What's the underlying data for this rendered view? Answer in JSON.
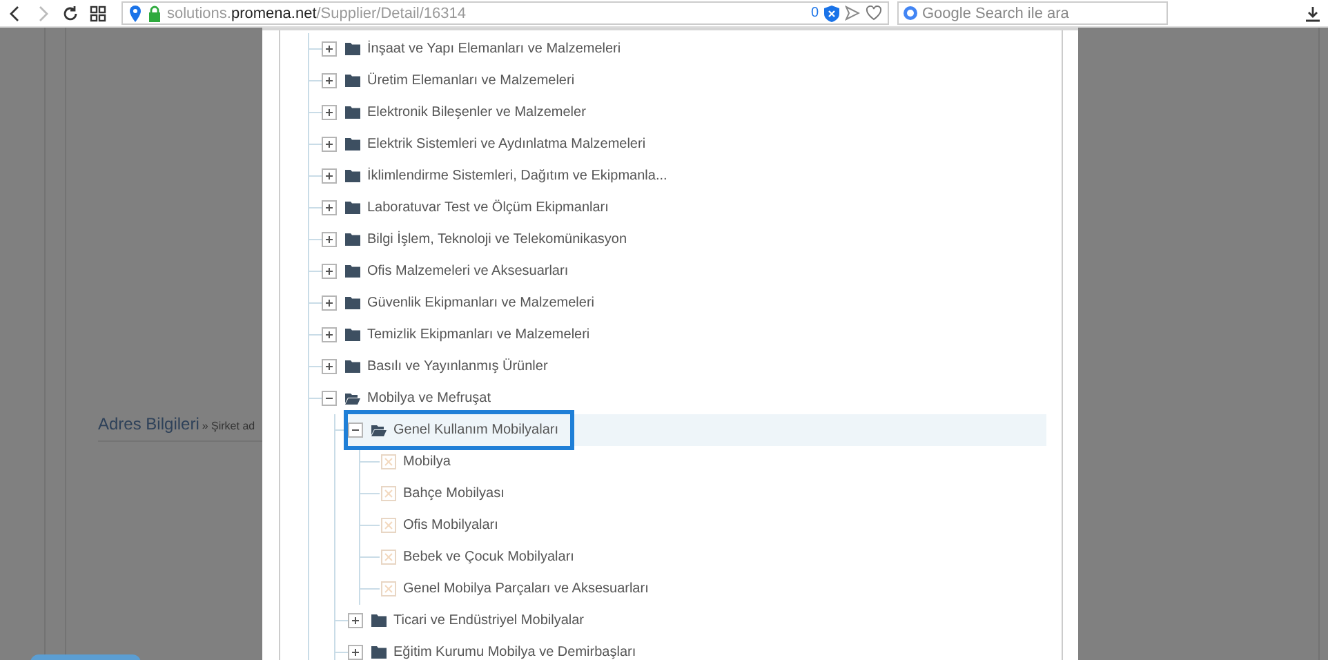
{
  "browser": {
    "url": "solutions.**promena.net**/Supplier/Detail/16314",
    "badge_count": "0",
    "search": {
      "placeholder": "Google Search ile ara"
    }
  },
  "background_page": {
    "section_title": "Adres Bilgileri",
    "breadcrumb": "» Şirket ad"
  },
  "category_tree": [
    {
      "label": "İnşaat ve Yapı Elemanları ve Malzemeleri",
      "kind": "folder",
      "expanded": false,
      "selected": false
    },
    {
      "label": "Üretim Elemanları ve Malzemeleri",
      "kind": "folder",
      "expanded": false,
      "selected": false
    },
    {
      "label": "Elektronik Bileşenler ve Malzemeler",
      "kind": "folder",
      "expanded": false,
      "selected": false
    },
    {
      "label": "Elektrik Sistemleri ve Aydınlatma Malzemeleri",
      "kind": "folder",
      "expanded": false,
      "selected": false
    },
    {
      "label": "İklimlendirme Sistemleri, Dağıtım ve Ekipmanla...",
      "kind": "folder",
      "expanded": false,
      "selected": false
    },
    {
      "label": "Laboratuvar Test ve Ölçüm Ekipmanları",
      "kind": "folder",
      "expanded": false,
      "selected": false
    },
    {
      "label": "Bilgi İşlem, Teknoloji ve Telekomünikasyon",
      "kind": "folder",
      "expanded": false,
      "selected": false
    },
    {
      "label": "Ofis Malzemeleri ve Aksesuarları",
      "kind": "folder",
      "expanded": false,
      "selected": false
    },
    {
      "label": "Güvenlik Ekipmanları ve Malzemeleri",
      "kind": "folder",
      "expanded": false,
      "selected": false
    },
    {
      "label": "Temizlik Ekipmanları ve Malzemeleri",
      "kind": "folder",
      "expanded": false,
      "selected": false
    },
    {
      "label": "Basılı ve Yayınlanmış Ürünler",
      "kind": "folder",
      "expanded": false,
      "selected": false
    },
    {
      "label": "Mobilya ve Mefruşat",
      "kind": "folder",
      "expanded": true,
      "selected": false,
      "children": [
        {
          "label": "Genel Kullanım Mobilyaları",
          "kind": "folder",
          "expanded": true,
          "selected": true,
          "children": [
            {
              "label": "Mobilya",
              "kind": "leaf",
              "checked": false,
              "selected": false
            },
            {
              "label": "Bahçe Mobilyası",
              "kind": "leaf",
              "checked": false,
              "selected": false
            },
            {
              "label": "Ofis Mobilyaları",
              "kind": "leaf",
              "checked": false,
              "selected": false
            },
            {
              "label": "Bebek ve Çocuk Mobilyaları",
              "kind": "leaf",
              "checked": false,
              "selected": false
            },
            {
              "label": "Genel Mobilya Parçaları ve Aksesuarları",
              "kind": "leaf",
              "checked": false,
              "selected": false
            }
          ]
        },
        {
          "label": "Ticari ve Endüstriyel Mobilyalar",
          "kind": "folder",
          "expanded": false,
          "selected": false
        },
        {
          "label": "Eğitim Kurumu Mobilya ve Demirbaşları",
          "kind": "folder",
          "expanded": false,
          "selected": false
        }
      ]
    }
  ]
}
